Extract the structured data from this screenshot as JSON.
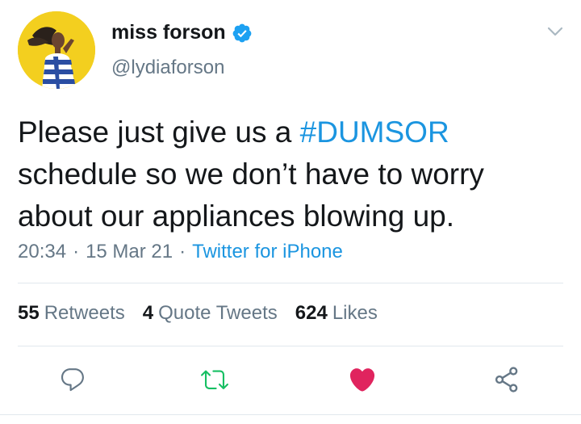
{
  "user": {
    "display_name": "miss forson",
    "handle": "@lydiaforson",
    "avatar_color": "#f3cf1f",
    "verified_color": "#1da1f2"
  },
  "tweet": {
    "text_before": "Please just give us a ",
    "hashtag": "#DUMSOR",
    "text_after": " schedule so we don’t have to worry about our appliances blowing up."
  },
  "meta": {
    "time": "20:34",
    "date": "15 Mar 21",
    "separator": "·",
    "source": "Twitter for iPhone"
  },
  "stats": {
    "retweets_count": "55",
    "retweets_label": "Retweets",
    "quotes_count": "4",
    "quotes_label": "Quote Tweets",
    "likes_count": "624",
    "likes_label": "Likes"
  },
  "colors": {
    "link": "#1b95e0",
    "secondary_text": "#657786",
    "retweet_green": "#17bf63",
    "like_red": "#e0245e",
    "divider": "#e1e8ed"
  },
  "icons": [
    "verified-badge-icon",
    "chevron-down-icon",
    "reply-icon",
    "retweet-icon",
    "like-icon",
    "share-icon"
  ]
}
